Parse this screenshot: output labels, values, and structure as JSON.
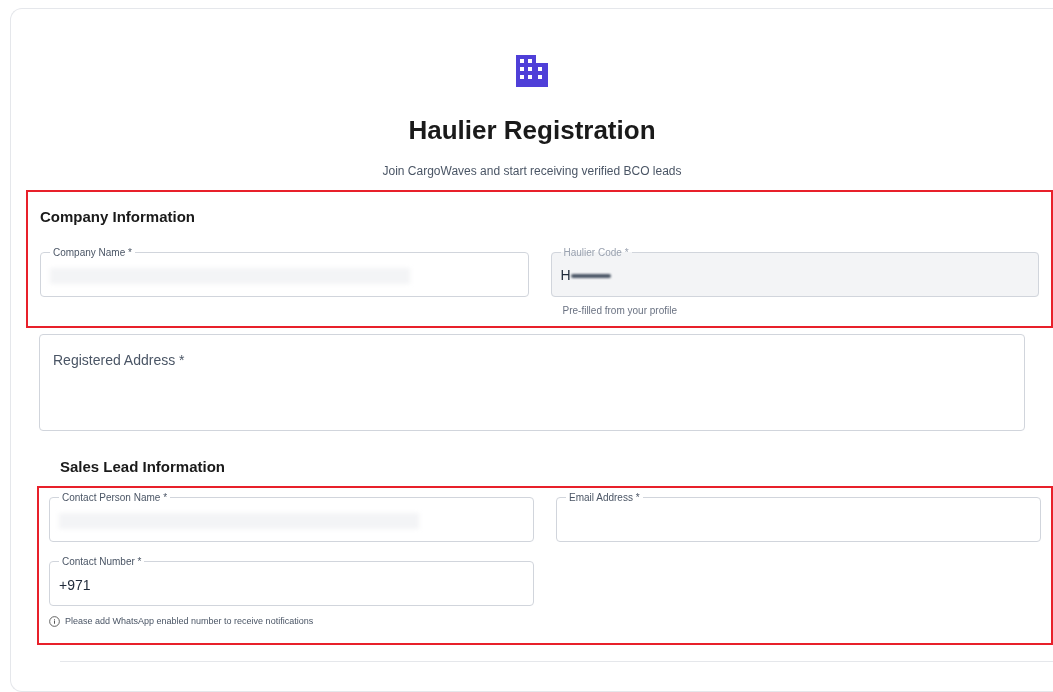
{
  "header": {
    "title": "Haulier Registration",
    "subtitle": "Join CargoWaves and start receiving verified BCO leads"
  },
  "sections": [
    {
      "heading": "Company Information",
      "highlighted": true,
      "rows": [
        [
          {
            "label": "Company Name *",
            "redacted": true,
            "readonly": false
          },
          {
            "label": "Haulier Code *",
            "value": "H",
            "redacted": true,
            "readonly": true,
            "helper": "Pre-filled from your profile"
          }
        ]
      ]
    },
    {
      "textarea": {
        "placeholder": "Registered Address *"
      }
    },
    {
      "heading": "Sales Lead Information",
      "highlighted": true,
      "rows": [
        [
          {
            "label": "Contact Person Name *",
            "redacted": true,
            "readonly": false
          },
          {
            "label": "Email Address *",
            "redacted": false,
            "readonly": false
          }
        ],
        [
          {
            "label": "Contact Number *",
            "value": "+971",
            "redacted": false,
            "readonly": false
          }
        ]
      ],
      "note": "Please add WhatsApp enabled number to receive notifications"
    }
  ]
}
